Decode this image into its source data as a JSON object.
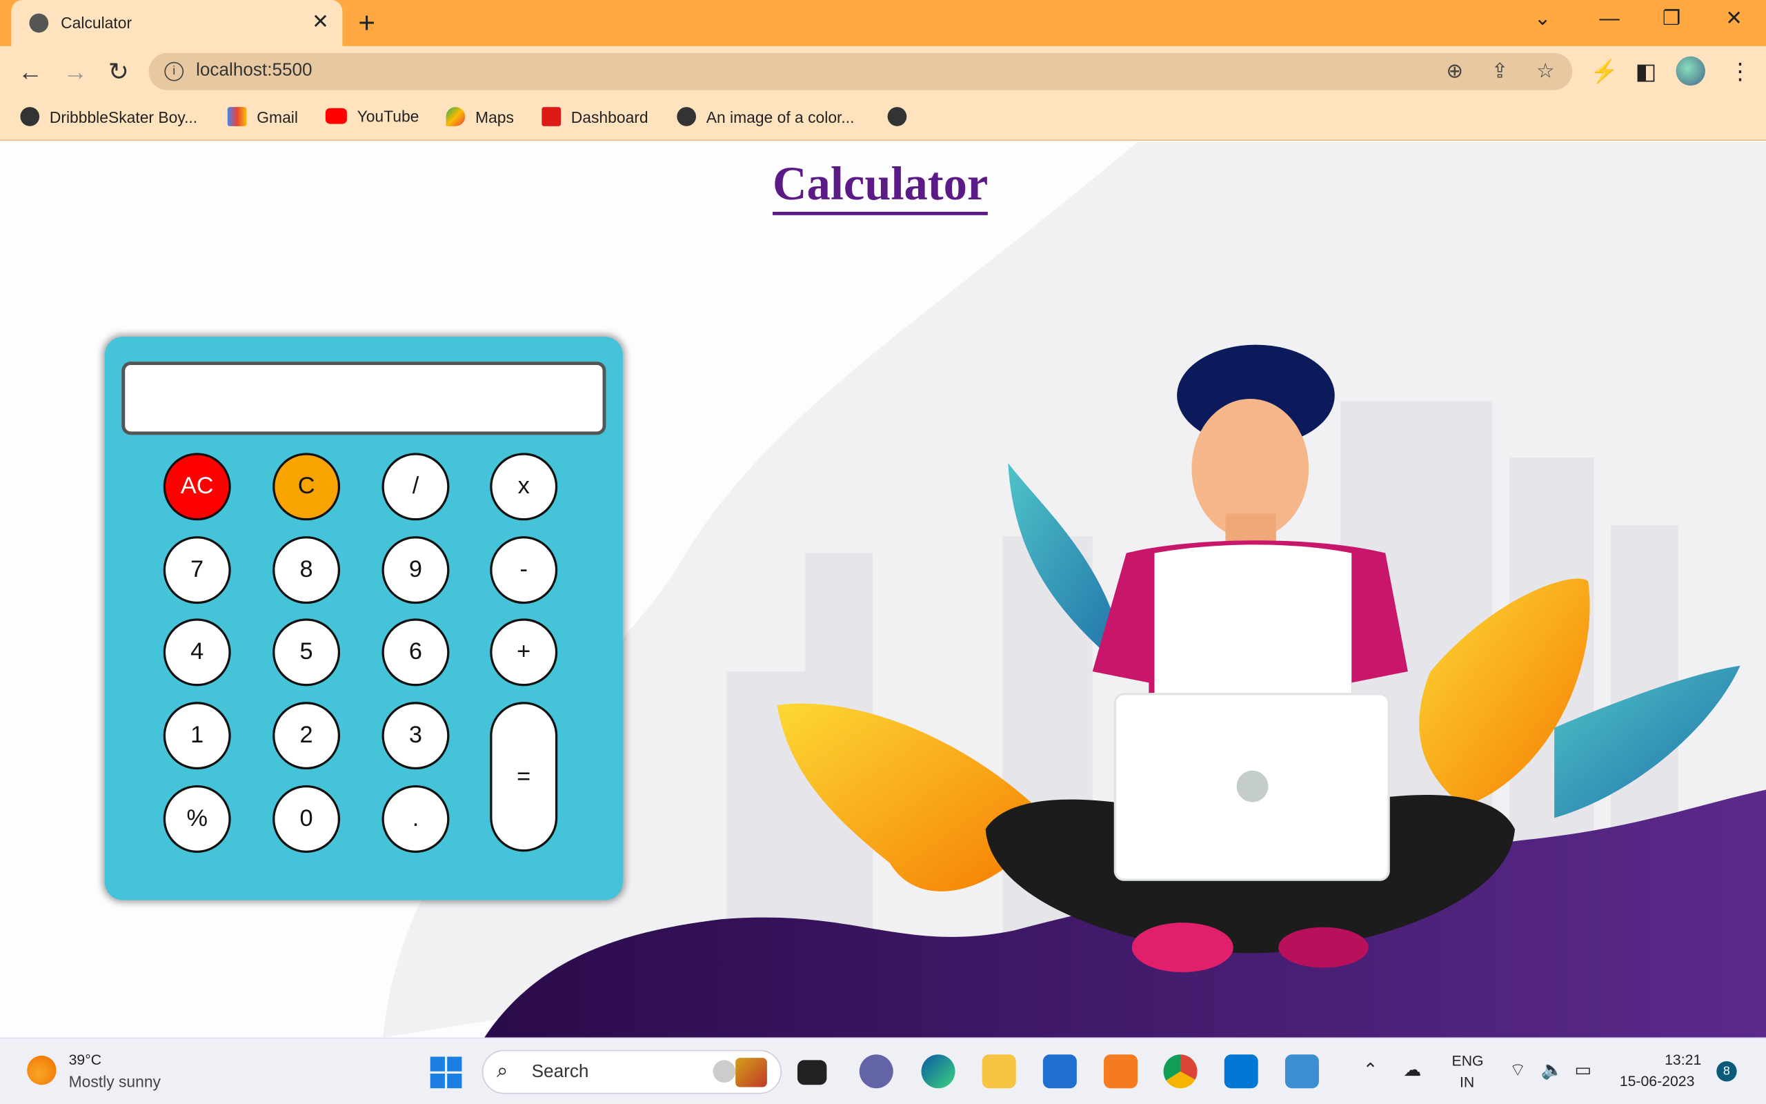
{
  "browser": {
    "tab_title": "Calculator",
    "url": "localhost:5500",
    "bookmarks": [
      {
        "label": "DribbbleSkater Boy...",
        "icon": "globe-icon"
      },
      {
        "label": "Gmail",
        "icon": "gmail-icon"
      },
      {
        "label": "YouTube",
        "icon": "youtube-icon"
      },
      {
        "label": "Maps",
        "icon": "maps-icon"
      },
      {
        "label": "Dashboard",
        "icon": "angular-icon"
      },
      {
        "label": "An image of a color...",
        "icon": "globe-icon"
      }
    ]
  },
  "page": {
    "title": "Calculator",
    "display_value": "",
    "keys": {
      "ac": "AC",
      "c": "C",
      "div": "/",
      "mul": "x",
      "k7": "7",
      "k8": "8",
      "k9": "9",
      "minus": "-",
      "k4": "4",
      "k5": "5",
      "k6": "6",
      "plus": "+",
      "k1": "1",
      "k2": "2",
      "k3": "3",
      "eq": "=",
      "pct": "%",
      "k0": "0",
      "dot": "."
    }
  },
  "taskbar": {
    "weather_temp": "39°C",
    "weather_desc": "Mostly sunny",
    "search_label": "Search",
    "lang_line1": "ENG",
    "lang_line2": "IN",
    "time": "13:21",
    "date": "15-06-2023",
    "notification_count": "8"
  },
  "colors": {
    "chrome_frame": "#ffa940",
    "chrome_toolbar": "#ffe3bf",
    "calc_body": "#45c4d9",
    "title_purple": "#5b1a86",
    "key_ac": "#ff0000",
    "key_c": "#f8a400"
  }
}
